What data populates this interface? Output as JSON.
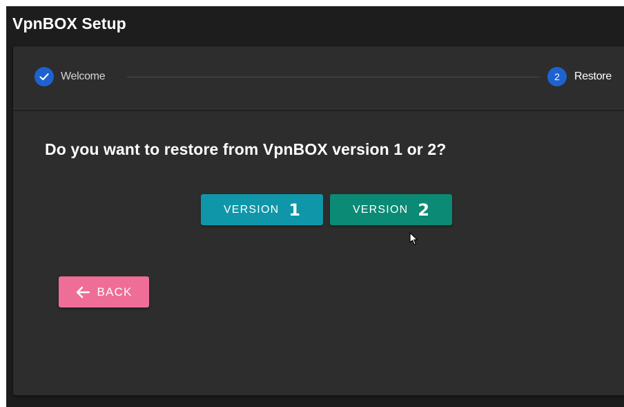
{
  "app": {
    "title": "VpnBOX Setup"
  },
  "stepper": {
    "steps": [
      {
        "number": "1",
        "label": "Welcome",
        "state": "completed",
        "icon": "check-icon"
      },
      {
        "number": "2",
        "label": "Restore",
        "state": "active"
      }
    ],
    "accent_color": "#1e62d0"
  },
  "content": {
    "question": "Do you want to restore from VpnBOX version 1 or 2?",
    "buttons": [
      {
        "label": "VERSION",
        "number": "1",
        "color": "#0f97a9"
      },
      {
        "label": "VERSION",
        "number": "2",
        "color": "#0b8a75"
      }
    ],
    "back": {
      "label": "BACK",
      "icon": "arrow-left-icon",
      "color": "#ee6e97"
    }
  }
}
